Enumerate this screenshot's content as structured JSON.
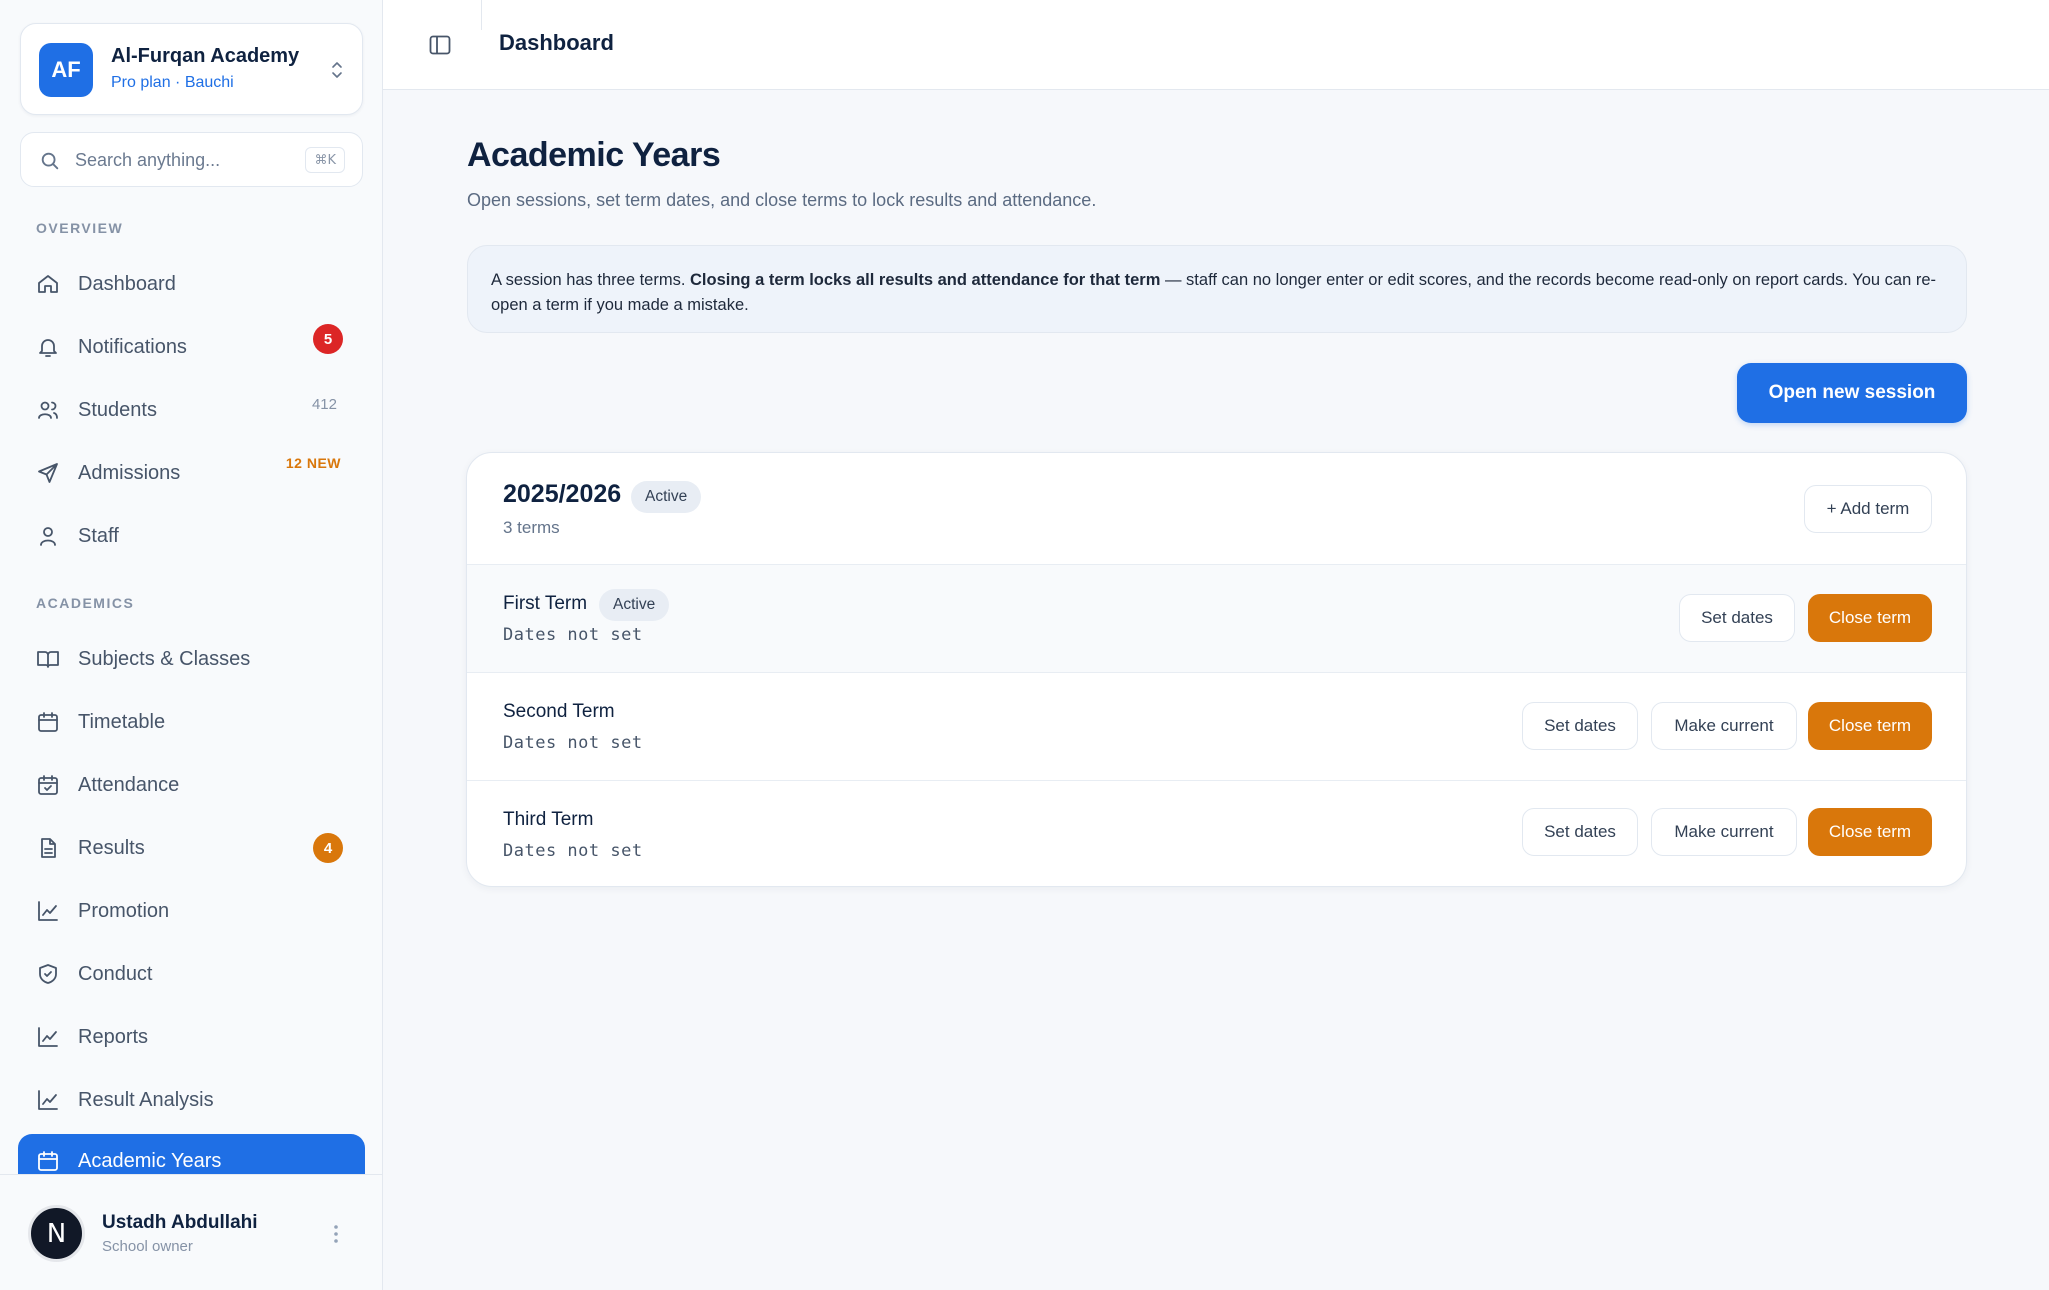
{
  "org": {
    "initials": "AF",
    "name": "Al-Furqan Academy",
    "plan": "Pro plan · Bauchi"
  },
  "search": {
    "placeholder": "Search anything...",
    "shortcut": "⌘K"
  },
  "sections": {
    "overview": "OVERVIEW",
    "academics": "ACADEMICS"
  },
  "nav": {
    "dashboard": "Dashboard",
    "notifications": {
      "label": "Notifications",
      "badge": "5"
    },
    "students": {
      "label": "Students",
      "count": "412"
    },
    "admissions": {
      "label": "Admissions",
      "tag": "12 NEW"
    },
    "staff": "Staff",
    "subjects": "Subjects & Classes",
    "timetable": "Timetable",
    "attendance": "Attendance",
    "results": {
      "label": "Results",
      "badge": "4"
    },
    "promotion": "Promotion",
    "conduct": "Conduct",
    "reports": "Reports",
    "result_analysis": "Result Analysis",
    "academic_years": "Academic Years"
  },
  "user": {
    "initial": "N",
    "name": "Ustadh Abdullahi",
    "role": "School owner"
  },
  "topbar": {
    "title": "Dashboard"
  },
  "page": {
    "title": "Academic Years",
    "subtitle": "Open sessions, set term dates, and close terms to lock results and attendance.",
    "notice_pre": "A session has three terms. ",
    "notice_bold": "Closing a term locks all results and attendance for that term",
    "notice_post": " — staff can no longer enter or edit scores, and the records become read-only on report cards. You can re-open a term if you made a mistake.",
    "open_session_label": "Open new session"
  },
  "session": {
    "name": "2025/2026",
    "status": "Active",
    "terms_count": "3 terms",
    "add_term_label": "+ Add term",
    "terms": [
      {
        "name": "First Term",
        "status": "Active",
        "dates": "Dates not set",
        "set_dates": "Set dates",
        "close": "Close term"
      },
      {
        "name": "Second Term",
        "dates": "Dates not set",
        "set_dates": "Set dates",
        "make_current": "Make current",
        "close": "Close term"
      },
      {
        "name": "Third Term",
        "dates": "Dates not set",
        "set_dates": "Set dates",
        "make_current": "Make current",
        "close": "Close term"
      }
    ]
  },
  "colors": {
    "primary": "#1f6fe5",
    "warning": "#d9770b",
    "danger": "#dc2626",
    "ink": "#0f2240"
  }
}
